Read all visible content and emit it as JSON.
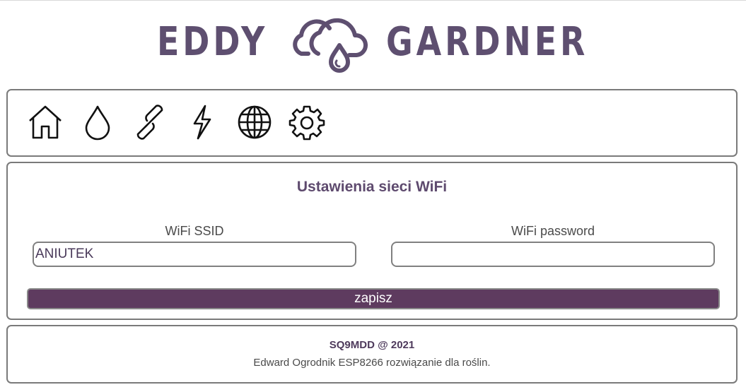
{
  "logo": {
    "left_text": "EDDY",
    "right_text": "GARDNER",
    "color": "#5e4f70",
    "icon": "cloud-drop-icon"
  },
  "nav": {
    "items": [
      {
        "icon": "home-icon"
      },
      {
        "icon": "water-drop-icon"
      },
      {
        "icon": "link-icon"
      },
      {
        "icon": "lightning-icon"
      },
      {
        "icon": "globe-icon"
      },
      {
        "icon": "gear-icon"
      }
    ]
  },
  "wifi_settings": {
    "title": "Ustawienia sieci WiFi",
    "ssid_label": "WiFi SSID",
    "ssid_value": "ANIUTEK",
    "password_label": "WiFi password",
    "password_value": "",
    "save_label": "zapisz"
  },
  "footer": {
    "title": "SQ9MDD @ 2021",
    "subtitle": "Edward Ogrodnik ESP8266 rozwiązanie dla roślin."
  },
  "colors": {
    "accent": "#5e3b5f",
    "border": "#7a7a7a",
    "title": "#5e4a6e"
  }
}
